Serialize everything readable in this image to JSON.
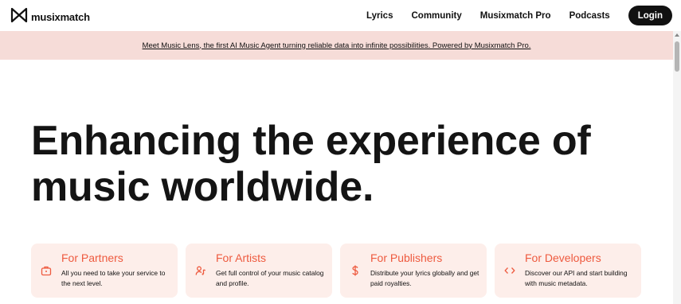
{
  "brand": {
    "name": "musixmatch",
    "logo_icon": "musixmatch-logo-icon"
  },
  "nav": {
    "links": [
      "Lyrics",
      "Community",
      "Musixmatch Pro",
      "Podcasts"
    ],
    "login_label": "Login"
  },
  "banner": {
    "text": "Meet Music Lens, the first AI Music Agent turning reliable data into infinite possibilities. Powered by Musixmatch Pro."
  },
  "hero": {
    "line1": "Enhancing the experience of",
    "line2": "music worldwide."
  },
  "cards": [
    {
      "title": "For Partners",
      "description": "All you need to take your service to the next level.",
      "icon": "briefcase-icon"
    },
    {
      "title": "For Artists",
      "description": "Get full control of your music catalog and profile.",
      "icon": "artist-icon"
    },
    {
      "title": "For Publishers",
      "description": "Distribute your lyrics globally and get paid royalties.",
      "icon": "dollar-icon"
    },
    {
      "title": "For Developers",
      "description": "Discover our API and start building with music metadata.",
      "icon": "code-icon"
    }
  ],
  "colors": {
    "accent": "#ee5a3f",
    "banner_bg": "#f6dcd8",
    "card_bg": "#fdeeea",
    "login_bg": "#111111"
  }
}
